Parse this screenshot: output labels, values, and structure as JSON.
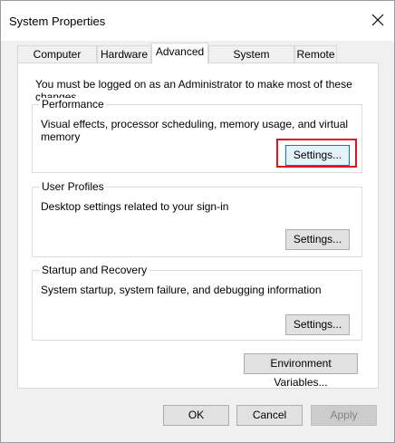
{
  "window": {
    "title": "System Properties",
    "close_icon": "close-icon"
  },
  "tabs": [
    {
      "label": "Computer Name"
    },
    {
      "label": "Hardware"
    },
    {
      "label": "Advanced"
    },
    {
      "label": "System Protection"
    },
    {
      "label": "Remote"
    }
  ],
  "active_tab": "Advanced",
  "admin_note": "You must be logged on as an Administrator to make most of these changes.",
  "performance": {
    "label": "Performance",
    "description": "Visual effects, processor scheduling, memory usage, and virtual memory",
    "button": "Settings..."
  },
  "user_profiles": {
    "label": "User Profiles",
    "description": "Desktop settings related to your sign-in",
    "button": "Settings..."
  },
  "startup_recovery": {
    "label": "Startup and Recovery",
    "description": "System startup, system failure, and debugging information",
    "button": "Settings..."
  },
  "env_button": "Environment Variables...",
  "footer": {
    "ok": "OK",
    "cancel": "Cancel",
    "apply": "Apply"
  },
  "colors": {
    "highlight": "#e0121c",
    "focus": "#0078d7"
  }
}
